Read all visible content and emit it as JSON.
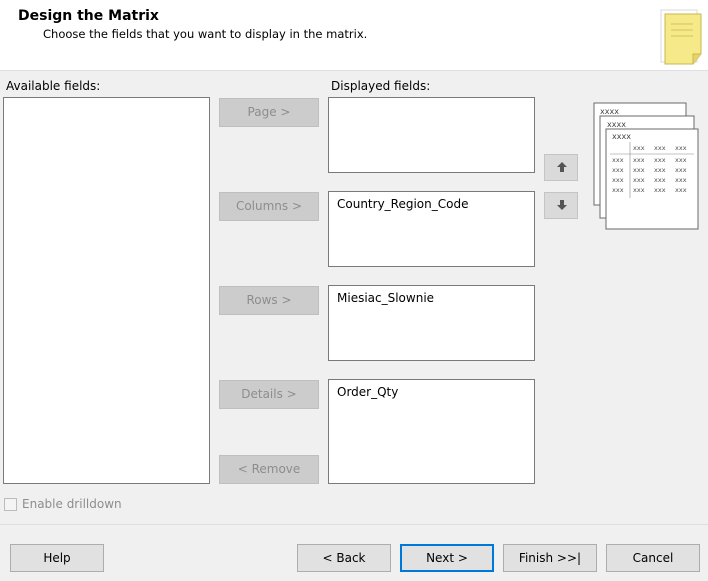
{
  "header": {
    "title": "Design the Matrix",
    "subtitle": "Choose the fields that you want to display in the matrix."
  },
  "available_fields": {
    "label": "Available fields:",
    "items": []
  },
  "displayed_fields": {
    "label": "Displayed fields:",
    "page_items": [],
    "columns_items": [
      "Country_Region_Code"
    ],
    "rows_items": [
      "Miesiac_Slownie"
    ],
    "details_items": [
      "Order_Qty"
    ]
  },
  "move_buttons": {
    "page": "Page >",
    "columns": "Columns >",
    "rows": "Rows >",
    "details": "Details >",
    "remove": "< Remove"
  },
  "order_buttons": {
    "up_icon": "arrow-up-icon",
    "down_icon": "arrow-down-icon"
  },
  "preview": {
    "header_text": "xxxx",
    "cell_text": "xxx"
  },
  "options": {
    "enable_drilldown_label": "Enable drilldown",
    "enable_drilldown_checked": false,
    "enable_drilldown_enabled": false
  },
  "footer": {
    "help": "Help",
    "back": "< Back",
    "next": "Next >",
    "finish": "Finish >>|",
    "cancel": "Cancel"
  },
  "colors": {
    "default_button_border": "#0078d7",
    "disabled_text": "#8d8d8d"
  }
}
